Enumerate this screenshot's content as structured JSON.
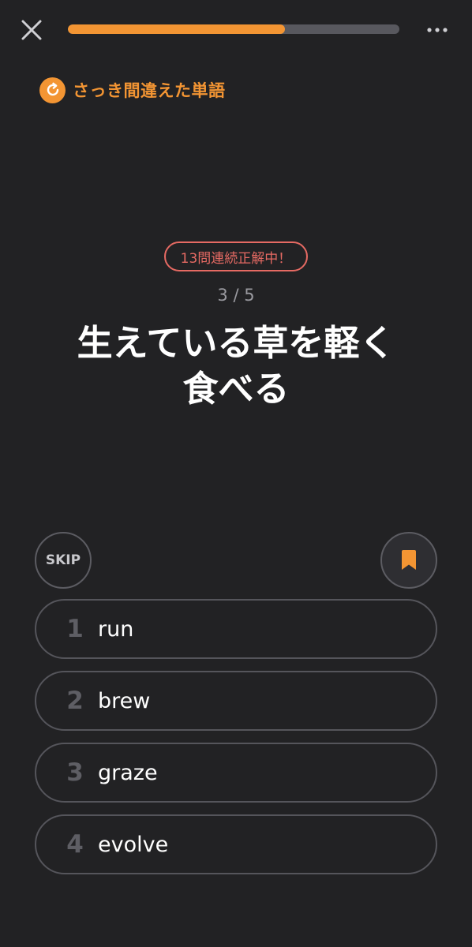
{
  "colors": {
    "background": "#222224",
    "accent": "#f39533",
    "streak": "#e66a63",
    "track": "#58585e"
  },
  "header": {
    "close_icon": "close-icon",
    "more_icon": "more-horizontal-icon",
    "progress": 0.655
  },
  "review": {
    "icon": "refresh-icon",
    "label": "さっき間違えた単語"
  },
  "streak": {
    "label": "13問連続正解中！"
  },
  "counter": {
    "text": "3 / 5"
  },
  "question": {
    "line1": "生えている草を軽く",
    "line2": "食べる"
  },
  "actions": {
    "skip_label": "SKIP",
    "bookmark_icon": "bookmark-icon"
  },
  "options": [
    {
      "number": "1",
      "text": "run"
    },
    {
      "number": "2",
      "text": "brew"
    },
    {
      "number": "3",
      "text": "graze"
    },
    {
      "number": "4",
      "text": "evolve"
    }
  ]
}
